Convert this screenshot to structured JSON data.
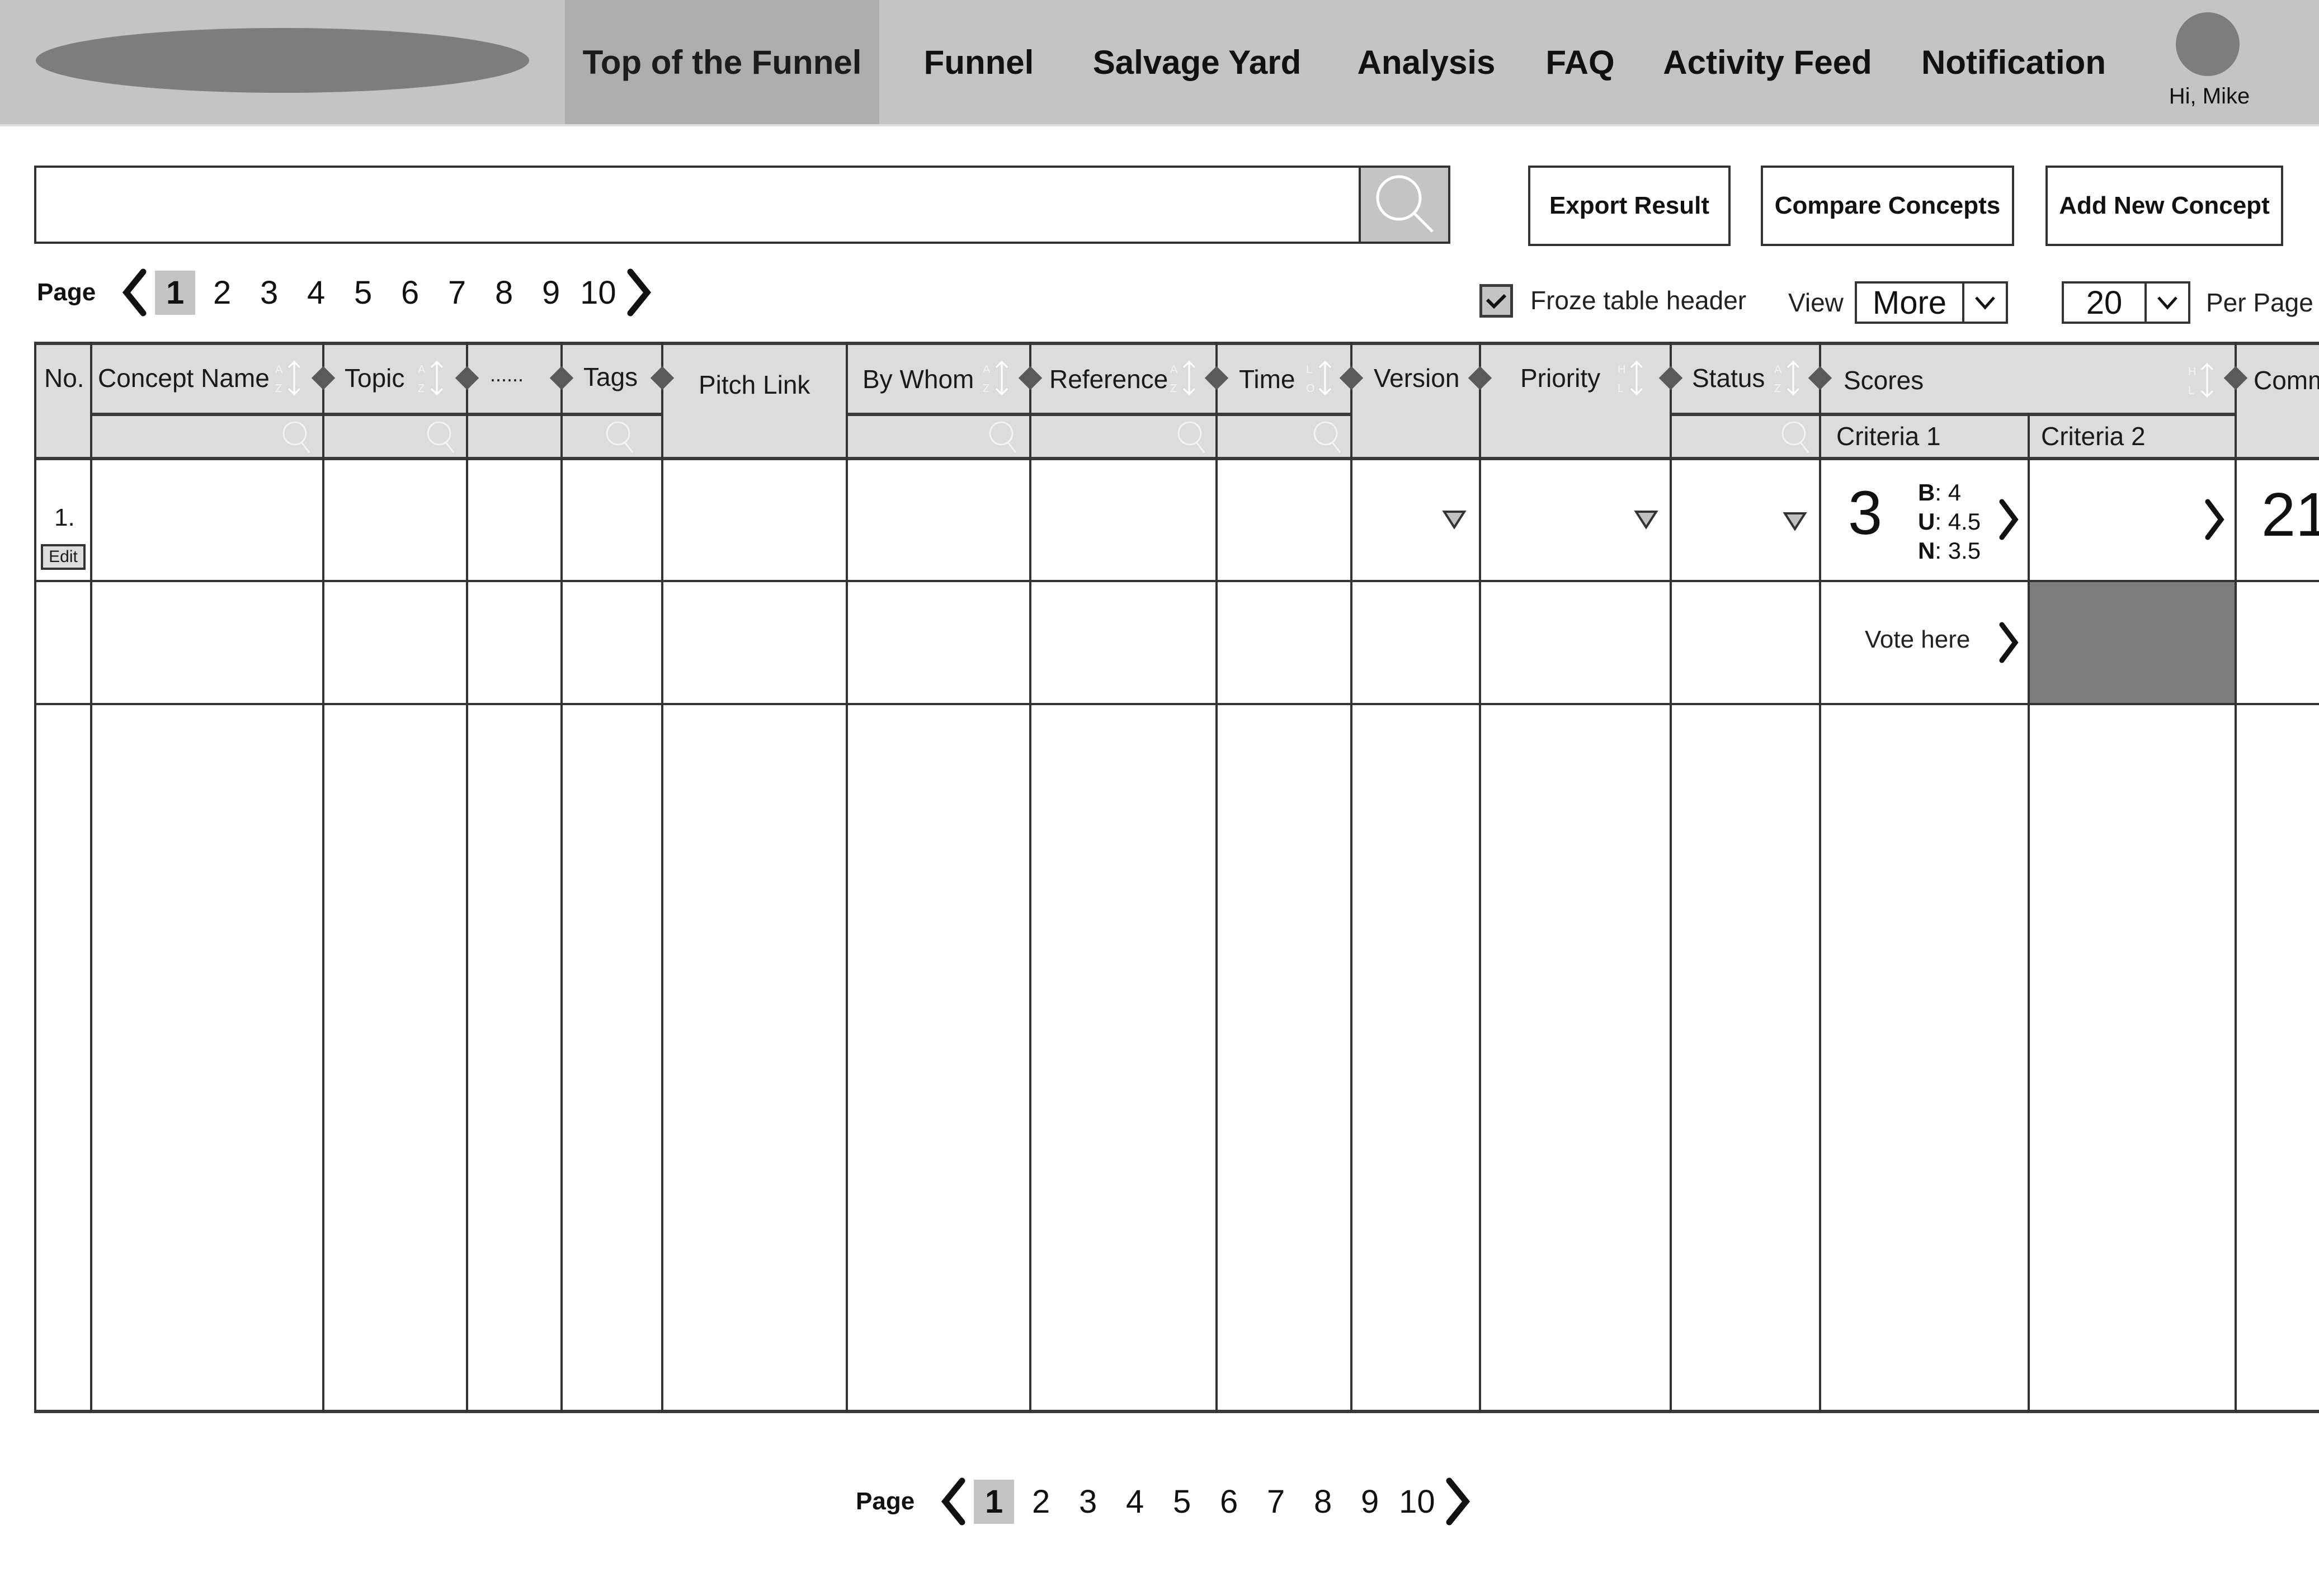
{
  "nav": {
    "logo": "logo-placeholder",
    "items": [
      {
        "label": "Top of the Funnel",
        "active": true
      },
      {
        "label": "Funnel",
        "active": false
      },
      {
        "label": "Salvage Yard",
        "active": false
      },
      {
        "label": "Analysis",
        "active": false
      },
      {
        "label": "FAQ",
        "active": false
      },
      {
        "label": "Activity Feed",
        "active": false
      },
      {
        "label": "Notification",
        "active": false
      }
    ],
    "greeting": "Hi, Mike"
  },
  "search": {
    "value": "",
    "placeholder": "",
    "button_icon": "search-icon"
  },
  "toolbar": {
    "export_label": "Export Result",
    "compare_label": "Compare Concepts",
    "add_label": "Add New Concept"
  },
  "pagination": {
    "label": "Page",
    "pages": [
      "1",
      "2",
      "3",
      "4",
      "5",
      "6",
      "7",
      "8",
      "9",
      "10"
    ],
    "current": "1",
    "prev_icon": "chevron-left-icon",
    "next_icon": "chevron-right-icon"
  },
  "options": {
    "froze_header_label": "Froze table header",
    "froze_header_checked": true,
    "view_label": "View",
    "view_value": "More",
    "per_page_value": "20",
    "per_page_label": "Per Page"
  },
  "table": {
    "columns": {
      "no": "No.",
      "concept_name": "Concept Name",
      "topic": "Topic",
      "more": "......",
      "tags": "Tags",
      "pitch_link": "Pitch Link",
      "by_whom": "By Whom",
      "reference": "Reference",
      "time": "Time",
      "version": "Version",
      "priority": "Priority",
      "status": "Status",
      "scores": "Scores",
      "criteria_1": "Criteria 1",
      "criteria_2": "Criteria 2",
      "comments": "Comm"
    },
    "sort_labels": {
      "alpha": [
        "A",
        "Z"
      ],
      "time": [
        "L",
        "O"
      ],
      "level": [
        "H",
        "L"
      ]
    },
    "rows": [
      {
        "no": "1.",
        "edit_label": "Edit",
        "criteria_1": {
          "score": "3",
          "b_label": "B",
          "b": "4",
          "u_label": "U",
          "u": "4.5",
          "n_label": "N",
          "n": "3.5"
        },
        "comments_count": "21"
      },
      {
        "vote_label": "Vote here"
      }
    ]
  }
}
